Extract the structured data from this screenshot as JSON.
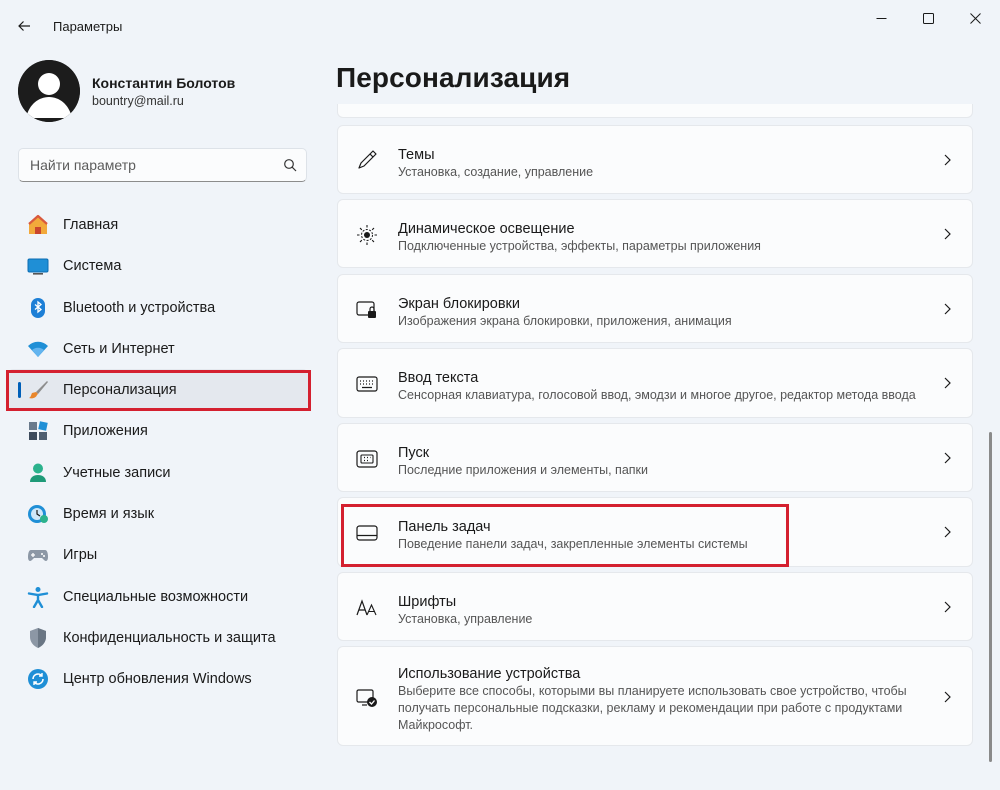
{
  "window": {
    "title": "Параметры",
    "back_icon": "arrow-left-icon",
    "controls": [
      "minimize-icon",
      "maximize-icon",
      "close-icon"
    ]
  },
  "account": {
    "name": "Константин Болотов",
    "email": "bountry@mail.ru"
  },
  "search": {
    "placeholder": "Найти параметр",
    "icon": "search-icon"
  },
  "nav": {
    "items": [
      {
        "label": "Главная",
        "icon": "home-icon",
        "active": false
      },
      {
        "label": "Система",
        "icon": "monitor-icon",
        "active": false
      },
      {
        "label": "Bluetooth и устройства",
        "icon": "bluetooth-icon",
        "active": false
      },
      {
        "label": "Сеть и Интернет",
        "icon": "wifi-icon",
        "active": false
      },
      {
        "label": "Персонализация",
        "icon": "brush-icon",
        "active": true
      },
      {
        "label": "Приложения",
        "icon": "apps-icon",
        "active": false
      },
      {
        "label": "Учетные записи",
        "icon": "person-icon",
        "active": false
      },
      {
        "label": "Время и язык",
        "icon": "clock-globe-icon",
        "active": false
      },
      {
        "label": "Игры",
        "icon": "gamepad-icon",
        "active": false
      },
      {
        "label": "Специальные возможности",
        "icon": "accessibility-icon",
        "active": false
      },
      {
        "label": "Конфиденциальность и защита",
        "icon": "shield-icon",
        "active": false
      },
      {
        "label": "Центр обновления Windows",
        "icon": "update-icon",
        "active": false
      }
    ]
  },
  "main": {
    "title": "Персонализация",
    "cards": [
      {
        "title": "Темы",
        "subtitle": "Установка, создание, управление",
        "icon": "pen-icon"
      },
      {
        "title": "Динамическое освещение",
        "subtitle": "Подключенные устройства, эффекты, параметры приложения",
        "icon": "lighting-icon"
      },
      {
        "title": "Экран блокировки",
        "subtitle": "Изображения экрана блокировки, приложения, анимация",
        "icon": "lock-screen-icon"
      },
      {
        "title": "Ввод текста",
        "subtitle": "Сенсорная клавиатура, голосовой ввод, эмодзи и многое другое, редактор метода ввода",
        "icon": "keyboard-icon"
      },
      {
        "title": "Пуск",
        "subtitle": "Последние приложения и элементы, папки",
        "icon": "start-icon"
      },
      {
        "title": "Панель задач",
        "subtitle": "Поведение панели задач, закрепленные элементы системы",
        "icon": "taskbar-icon"
      },
      {
        "title": "Шрифты",
        "subtitle": "Установка, управление",
        "icon": "fonts-icon"
      },
      {
        "title": "Использование устройства",
        "subtitle": "Выберите все способы, которыми вы планируете использовать свое устройство, чтобы получать персональные подсказки, рекламу и рекомендации при работе с продуктами Майкрософт.",
        "icon": "device-usage-icon"
      }
    ]
  },
  "colors": {
    "background": "#f0f4f9",
    "card": "#fbfcfd",
    "accent": "#005fb8",
    "highlight": "#d4202f"
  }
}
